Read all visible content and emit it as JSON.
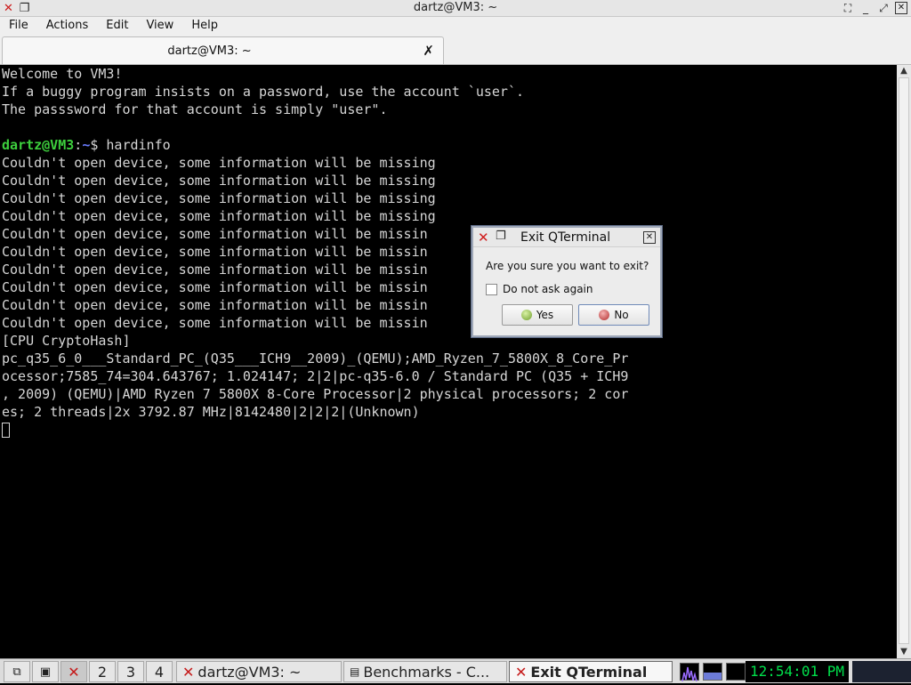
{
  "window": {
    "title": "dartz@VM3: ~",
    "close_icon": "✕",
    "restore_icon": "❐"
  },
  "menubar": {
    "items": [
      "File",
      "Actions",
      "Edit",
      "View",
      "Help"
    ]
  },
  "tabs": [
    {
      "label": "dartz@VM3: ~"
    }
  ],
  "terminal": {
    "lines": [
      "Welcome to VM3!",
      "If a buggy program insists on a password, use the account `user`.",
      "The passsword for that account is simply \"user\".",
      "",
      "Couldn't open device, some information will be missing",
      "Couldn't open device, some information will be missing",
      "Couldn't open device, some information will be missing",
      "Couldn't open device, some information will be missing",
      "Couldn't open device, some information will be missin",
      "Couldn't open device, some information will be missin",
      "Couldn't open device, some information will be missin",
      "Couldn't open device, some information will be missin",
      "Couldn't open device, some information will be missin",
      "Couldn't open device, some information will be missin",
      "[CPU CryptoHash]",
      "pc_q35_6_0___Standard_PC_(Q35___ICH9__2009)_(QEMU);AMD_Ryzen_7_5800X_8_Core_Pr",
      "ocessor;7585_74=304.643767; 1.024147; 2|2|pc-q35-6.0 / Standard PC (Q35 + ICH9",
      ", 2009) (QEMU)|AMD Ryzen 7 5800X 8-Core Processor|2 physical processors; 2 cor",
      "es; 2 threads|2x 3792.87 MHz|8142480|2|2|2|(Unknown)"
    ],
    "prompt_user": "dartz@VM3",
    "prompt_sep": ":",
    "prompt_path": "~",
    "prompt_dollar": "$ ",
    "command": "hardinfo"
  },
  "dialog": {
    "title": "Exit QTerminal",
    "message": "Are you sure you want to exit?",
    "checkbox_label": "Do not ask again",
    "yes_label": "Yes",
    "no_label": "No"
  },
  "taskbar": {
    "workspaces": [
      "2",
      "3",
      "4"
    ],
    "tasks": [
      {
        "label": "dartz@VM3: ~"
      },
      {
        "label": "Benchmarks - C..."
      },
      {
        "label": "Exit QTerminal"
      }
    ],
    "clock": "12:54:01 PM"
  }
}
